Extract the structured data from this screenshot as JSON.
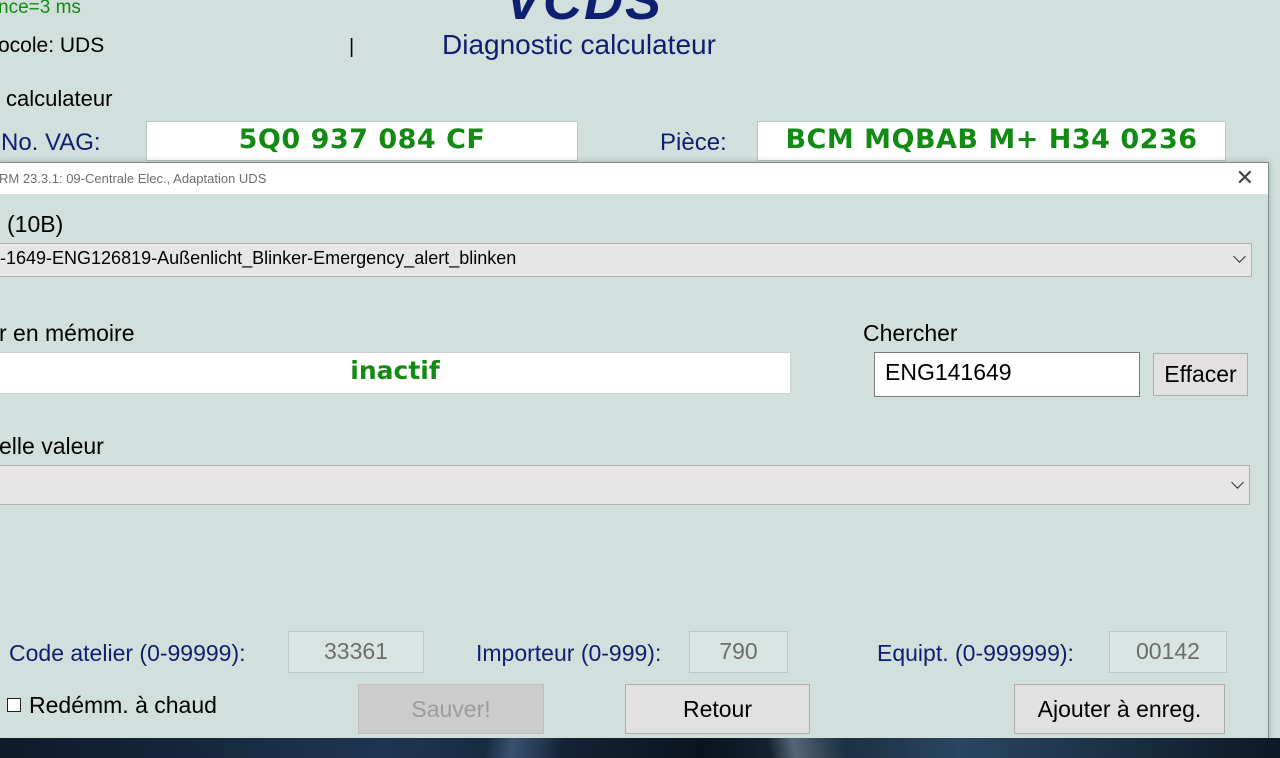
{
  "main_window": {
    "latency": "nce=3 ms",
    "protocol": "ocole: UDS",
    "cursor": "|",
    "logo": "VCDS",
    "subtitle": "Diagnostic calculateur",
    "section": "calculateur",
    "vag_label": "No. VAG:",
    "vag_value": "5Q0 937 084 CF",
    "part_label": "Pièce:",
    "part_value": "BCM MQBAB M+  H34 0236"
  },
  "dialog": {
    "title": "RM 23.3.1: 09-Centrale Elec.,  Adaptation UDS",
    "channel_label": "(10B)",
    "channel_select": "-1649-ENG126819-Außenlicht_Blinker-Emergency_alert_blinken",
    "stored_label": "r en mémoire",
    "stored_value": "inactif",
    "search_label": "Chercher",
    "search_value": "ENG141649",
    "clear_button": "Effacer",
    "new_value_label": "elle valeur",
    "new_value_select": "",
    "workshop_label": "Code atelier (0-99999):",
    "workshop_value": "33361",
    "importer_label": "Importeur (0-999):",
    "importer_value": "790",
    "equip_label": "Equipt. (0-999999):",
    "equip_value": "00142",
    "hot_restart_label": "Redémm. à chaud",
    "save_button": "Sauver!",
    "back_button": "Retour",
    "add_log_button": "Ajouter à enreg."
  }
}
